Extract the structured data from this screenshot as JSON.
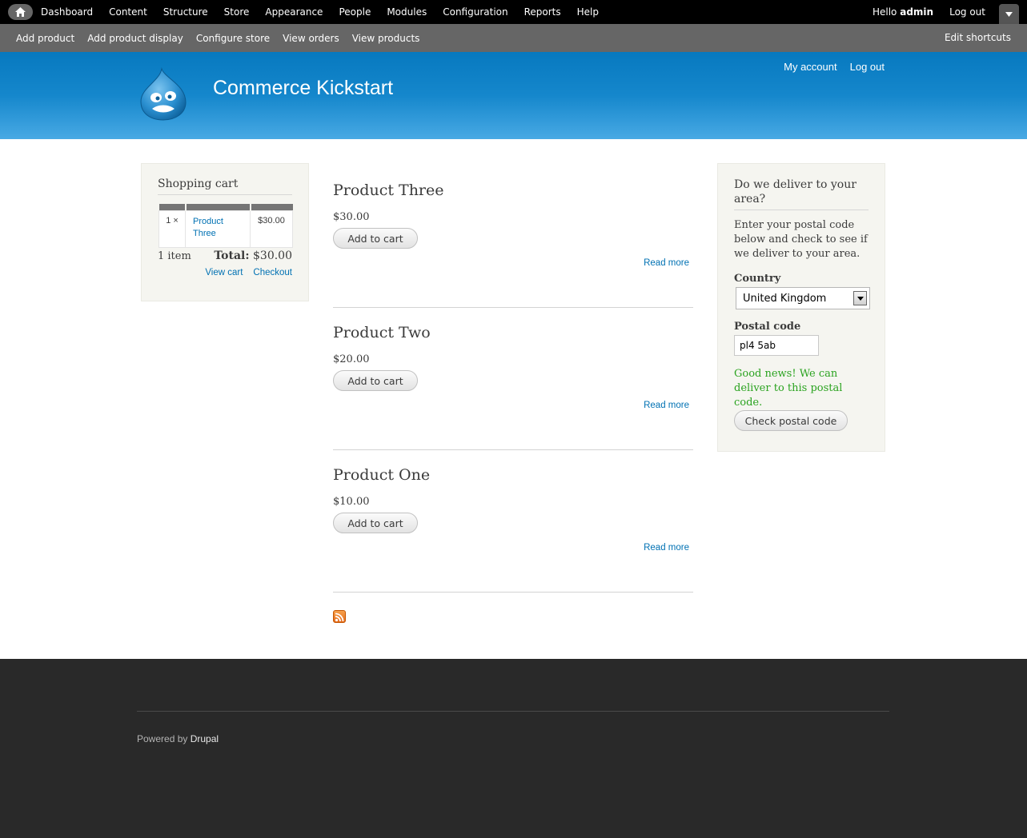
{
  "toolbar": {
    "menu": [
      "Dashboard",
      "Content",
      "Structure",
      "Store",
      "Appearance",
      "People",
      "Modules",
      "Configuration",
      "Reports",
      "Help"
    ],
    "hello": "Hello",
    "user": "admin",
    "logout": "Log out"
  },
  "shortcuts": {
    "links": [
      "Add product",
      "Add product display",
      "Configure store",
      "View orders",
      "View products"
    ],
    "edit": "Edit shortcuts"
  },
  "header": {
    "site_name": "Commerce Kickstart",
    "my_account": "My account",
    "logout": "Log out"
  },
  "cart": {
    "title": "Shopping cart",
    "item_qty": "1 ×",
    "item_title": "Product Three",
    "item_price": "$30.00",
    "count": "1 item",
    "total_label": "Total:",
    "total_value": "$30.00",
    "view_cart": "View cart",
    "checkout": "Checkout"
  },
  "products": [
    {
      "title": "Product Three",
      "price": "$30.00",
      "button": "Add to cart",
      "more": "Read more"
    },
    {
      "title": "Product Two",
      "price": "$20.00",
      "button": "Add to cart",
      "more": "Read more"
    },
    {
      "title": "Product One",
      "price": "$10.00",
      "button": "Add to cart",
      "more": "Read more"
    }
  ],
  "deliver": {
    "title": "Do we deliver to your area?",
    "description": "Enter your postal code below and check to see if we deliver to your area.",
    "country_label": "Country",
    "country_value": "United Kingdom",
    "postal_label": "Postal code",
    "postal_value": "pl4 5ab",
    "message": "Good news! We can deliver to this postal code.",
    "button": "Check postal code"
  },
  "footer": {
    "powered": "Powered by",
    "drupal": "Drupal"
  },
  "colors": {
    "header_blue": "#1587cc",
    "link": "#0071b3",
    "success": "#2ba320",
    "footer_bg": "#292929"
  }
}
